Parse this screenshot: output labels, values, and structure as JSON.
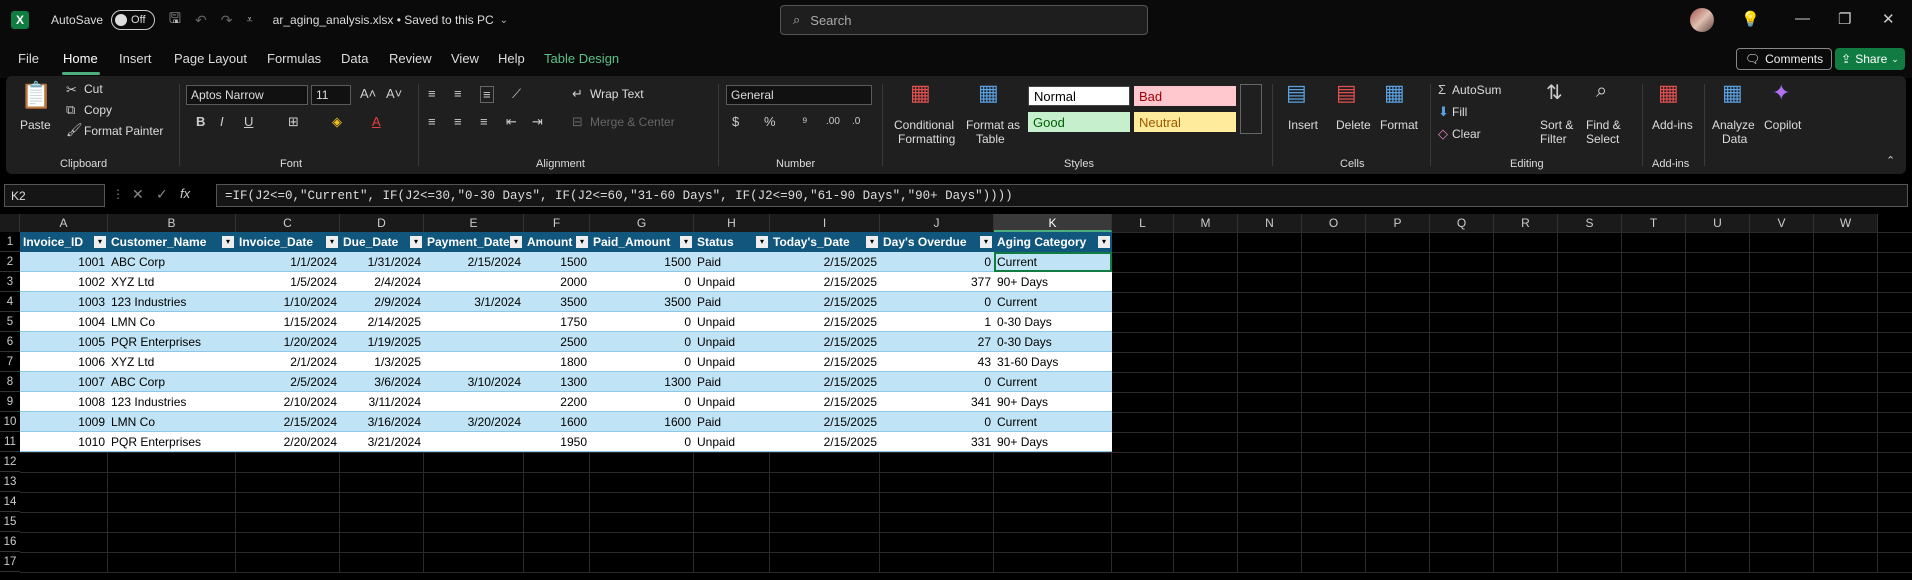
{
  "title_bar": {
    "autosave_label": "AutoSave",
    "autosave_state": "Off",
    "filename": "ar_aging_analysis.xlsx • Saved to this PC"
  },
  "search": {
    "placeholder": "Search"
  },
  "menu": {
    "items": [
      "File",
      "Home",
      "Insert",
      "Page Layout",
      "Formulas",
      "Data",
      "Review",
      "View",
      "Help",
      "Table Design"
    ],
    "active": "Home",
    "comments_label": "Comments",
    "share_label": "Share"
  },
  "ribbon": {
    "clipboard": {
      "paste": "Paste",
      "cut": "Cut",
      "copy": "Copy",
      "format_painter": "Format Painter",
      "group": "Clipboard"
    },
    "font": {
      "name": "Aptos Narrow",
      "size": "11",
      "group": "Font"
    },
    "alignment": {
      "wrap_text": "Wrap Text",
      "merge_center": "Merge & Center",
      "group": "Alignment"
    },
    "number": {
      "format": "General",
      "group": "Number"
    },
    "styles": {
      "conditional": "Conditional",
      "conditional2": "Formatting",
      "format_as": "Format as",
      "table": "Table",
      "normal": "Normal",
      "bad": "Bad",
      "good": "Good",
      "neutral": "Neutral",
      "group": "Styles"
    },
    "cells": {
      "insert": "Insert",
      "delete": "Delete",
      "format": "Format",
      "group": "Cells"
    },
    "editing": {
      "autosum": "AutoSum",
      "fill": "Fill",
      "clear": "Clear",
      "sort": "Sort &",
      "filter": "Filter",
      "find": "Find &",
      "select": "Select",
      "group": "Editing"
    },
    "addins": {
      "label": "Add-ins",
      "group": "Add-ins"
    },
    "analyze": {
      "label1": "Analyze",
      "label2": "Data"
    },
    "copilot": {
      "label": "Copilot"
    }
  },
  "formula_bar": {
    "name_box": "K2",
    "formula": "=IF(J2<=0,\"Current\", IF(J2<=30,\"0-30 Days\", IF(J2<=60,\"31-60 Days\", IF(J2<=90,\"61-90 Days\",\"90+ Days\"))))"
  },
  "sheet": {
    "columns": [
      "A",
      "B",
      "C",
      "D",
      "E",
      "F",
      "G",
      "H",
      "I",
      "J",
      "K",
      "L",
      "M",
      "N",
      "O",
      "P",
      "Q",
      "R",
      "S",
      "T",
      "U",
      "V",
      "W"
    ],
    "selected_column": "K",
    "row_numbers": [
      "1",
      "2",
      "3",
      "4",
      "5",
      "6",
      "7",
      "8",
      "9",
      "10",
      "11",
      "12",
      "13",
      "14",
      "15",
      "16",
      "17"
    ],
    "headers": [
      "Invoice_ID",
      "Customer_Name",
      "Invoice_Date",
      "Due_Date",
      "Payment_Date",
      "Amount",
      "Paid_Amount",
      "Status",
      "Today's_Date",
      "Day's Overdue",
      "Aging Category"
    ],
    "rows": [
      [
        "1001",
        "ABC Corp",
        "1/1/2024",
        "1/31/2024",
        "2/15/2024",
        "1500",
        "1500",
        "Paid",
        "2/15/2025",
        "0",
        "Current"
      ],
      [
        "1002",
        "XYZ Ltd",
        "1/5/2024",
        "2/4/2024",
        "",
        "2000",
        "0",
        "Unpaid",
        "2/15/2025",
        "377",
        "90+ Days"
      ],
      [
        "1003",
        "123 Industries",
        "1/10/2024",
        "2/9/2024",
        "3/1/2024",
        "3500",
        "3500",
        "Paid",
        "2/15/2025",
        "0",
        "Current"
      ],
      [
        "1004",
        "LMN Co",
        "1/15/2024",
        "2/14/2025",
        "",
        "1750",
        "0",
        "Unpaid",
        "2/15/2025",
        "1",
        "0-30 Days"
      ],
      [
        "1005",
        "PQR Enterprises",
        "1/20/2024",
        "1/19/2025",
        "",
        "2500",
        "0",
        "Unpaid",
        "2/15/2025",
        "27",
        "0-30 Days"
      ],
      [
        "1006",
        "XYZ Ltd",
        "2/1/2024",
        "1/3/2025",
        "",
        "1800",
        "0",
        "Unpaid",
        "2/15/2025",
        "43",
        "31-60 Days"
      ],
      [
        "1007",
        "ABC Corp",
        "2/5/2024",
        "3/6/2024",
        "3/10/2024",
        "1300",
        "1300",
        "Paid",
        "2/15/2025",
        "0",
        "Current"
      ],
      [
        "1008",
        "123 Industries",
        "2/10/2024",
        "3/11/2024",
        "",
        "2200",
        "0",
        "Unpaid",
        "2/15/2025",
        "341",
        "90+ Days"
      ],
      [
        "1009",
        "LMN Co",
        "2/15/2024",
        "3/16/2024",
        "3/20/2024",
        "1600",
        "1600",
        "Paid",
        "2/15/2025",
        "0",
        "Current"
      ],
      [
        "1010",
        "PQR Enterprises",
        "2/20/2024",
        "3/21/2024",
        "",
        "1950",
        "0",
        "Unpaid",
        "2/15/2025",
        "331",
        "90+ Days"
      ]
    ]
  },
  "colors": {
    "header_fill": "#11567c",
    "band_fill": "#c0e4f5",
    "row_fill": "#ffffff",
    "accent": "#107c41"
  }
}
